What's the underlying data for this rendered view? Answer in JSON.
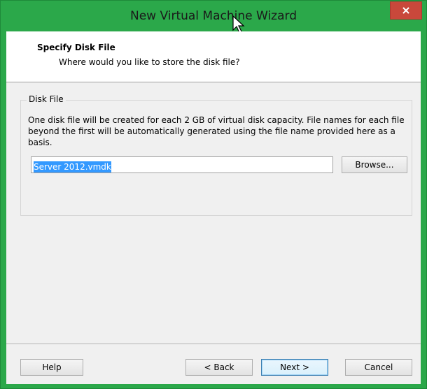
{
  "window": {
    "title": "New Virtual Machine Wizard",
    "close_label": "×"
  },
  "header": {
    "title": "Specify Disk File",
    "subtitle": "Where would you like to store the disk file?"
  },
  "disk_file_group": {
    "legend": "Disk File",
    "description": "One disk file will be created for each 2 GB of virtual disk capacity. File names for each file beyond the first will be automatically generated using the file name provided here as a basis.",
    "path_value": "Server 2012.vmdk",
    "browse_label": "Browse..."
  },
  "footer": {
    "help_label": "Help",
    "back_label": "< Back",
    "next_label": "Next >",
    "cancel_label": "Cancel"
  },
  "colors": {
    "titlebar": "#2ba84a",
    "close_button": "#c9483b",
    "selection": "#3399ff"
  },
  "icons": {
    "close": "close-icon",
    "cursor": "mouse-pointer-icon"
  }
}
